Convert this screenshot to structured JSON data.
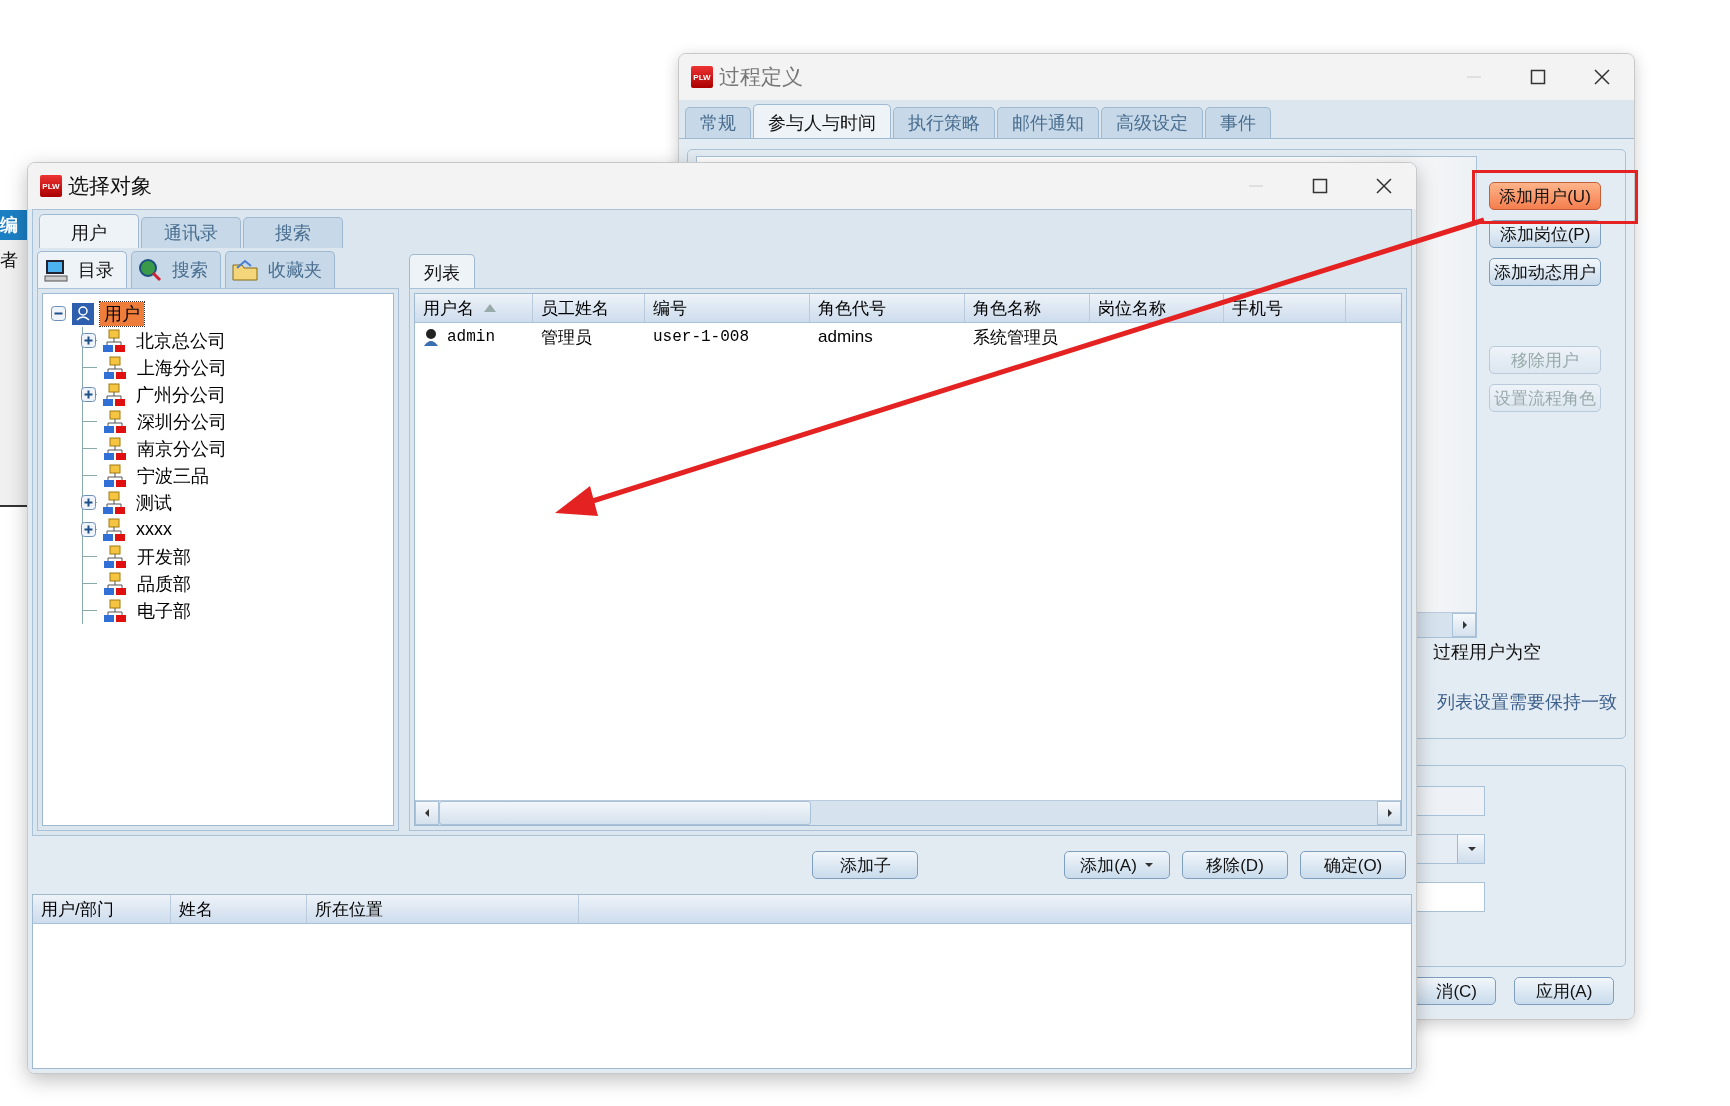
{
  "left_window": {
    "header": "编",
    "label": "者"
  },
  "back_window": {
    "logo": "PLW",
    "title": "过程定义",
    "tabs": [
      {
        "label": "常规",
        "selected": false
      },
      {
        "label": "参与人与时间",
        "selected": true
      },
      {
        "label": "执行策略",
        "selected": false
      },
      {
        "label": "邮件通知",
        "selected": false
      },
      {
        "label": "高级设定",
        "selected": false
      },
      {
        "label": "事件",
        "selected": false
      }
    ],
    "side_button_groups": [
      [
        {
          "label": "添加用户(U)",
          "highlighted": true,
          "disabled": false
        },
        {
          "label": "添加岗位(P)",
          "highlighted": false,
          "disabled": false
        },
        {
          "label": "添加动态用户",
          "highlighted": false,
          "disabled": false
        }
      ],
      [
        {
          "label": "移除用户",
          "highlighted": false,
          "disabled": true
        },
        {
          "label": "设置流程角色",
          "highlighted": false,
          "disabled": true
        }
      ]
    ],
    "notes": [
      {
        "text": "过程用户为空",
        "kind": "plain"
      },
      {
        "text": "列表设置需要保持一致",
        "kind": "hint"
      }
    ],
    "footer_buttons": [
      "消(C)",
      "应用(A)"
    ]
  },
  "select_window": {
    "logo": "PLW",
    "title": "选择对象",
    "tabs": [
      {
        "label": "用户",
        "selected": true
      },
      {
        "label": "通讯录",
        "selected": false
      },
      {
        "label": "搜索",
        "selected": false
      }
    ],
    "subtabs": [
      {
        "label": "目录",
        "kind": "computer",
        "selected": true
      },
      {
        "label": "搜索",
        "kind": "globe",
        "selected": false
      },
      {
        "label": "收藏夹",
        "kind": "folder",
        "selected": false
      }
    ],
    "tree": {
      "label": "用户",
      "expanded": true,
      "selected": true,
      "children": [
        {
          "label": "北京总公司",
          "expandable": true
        },
        {
          "label": "上海分公司",
          "expandable": false
        },
        {
          "label": "广州分公司",
          "expandable": true
        },
        {
          "label": "深圳分公司",
          "expandable": false
        },
        {
          "label": "南京分公司",
          "expandable": false
        },
        {
          "label": "宁波三品",
          "expandable": false
        },
        {
          "label": "测试",
          "expandable": true
        },
        {
          "label": "xxxx",
          "expandable": true
        },
        {
          "label": "开发部",
          "expandable": false
        },
        {
          "label": "品质部",
          "expandable": false
        },
        {
          "label": "电子部",
          "expandable": false
        }
      ]
    },
    "list_tab": "列表",
    "table": {
      "columns": [
        {
          "label": "用户名",
          "sorted": true
        },
        {
          "label": "员工姓名",
          "sorted": false
        },
        {
          "label": "编号",
          "sorted": false
        },
        {
          "label": "角色代号",
          "sorted": false
        },
        {
          "label": "角色名称",
          "sorted": false
        },
        {
          "label": "岗位名称",
          "sorted": false
        },
        {
          "label": "手机号",
          "sorted": false
        }
      ],
      "rows": [
        {
          "cells": [
            "admin",
            "管理员",
            "user-1-008",
            "admins",
            "系统管理员"
          ]
        }
      ]
    },
    "action_button_groups": [
      [
        {
          "label": "添加子",
          "dropdown": false
        }
      ],
      [
        {
          "label": "添加(A)",
          "dropdown": true
        },
        {
          "label": "移除(D)",
          "dropdown": false
        },
        {
          "label": "确定(O)",
          "dropdown": false
        }
      ]
    ],
    "selected_table": {
      "columns": [
        "用户/部门",
        "姓名",
        "所在位置"
      ]
    }
  }
}
